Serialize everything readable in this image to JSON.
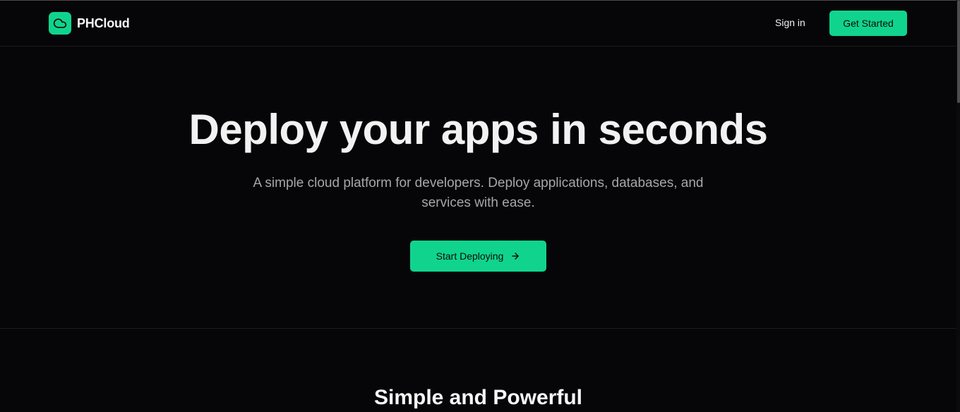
{
  "brand": {
    "name": "PHCloud",
    "icon": "cloud-icon",
    "color": "#10d48e"
  },
  "nav": {
    "signin_label": "Sign in",
    "cta_label": "Get Started"
  },
  "hero": {
    "title": "Deploy your apps in seconds",
    "subtitle": "A simple cloud platform for developers. Deploy applications, databases, and services with ease.",
    "cta_label": "Start Deploying",
    "cta_icon": "arrow-right-icon"
  },
  "features": {
    "title": "Simple and Powerful"
  },
  "colors": {
    "background": "#060608",
    "accent": "#10d48e",
    "text_primary": "#f2f2f2",
    "text_muted": "#a6a6ab"
  }
}
